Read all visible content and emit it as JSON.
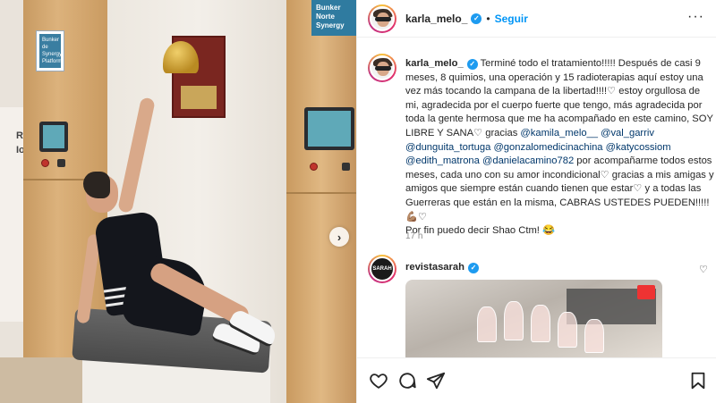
{
  "photo": {
    "sign_left_text": "Bunker de Synergy Platform",
    "sign_right_text": "Bunker Norte Synergy",
    "wall_text_line1": "Rad",
    "wall_text_line2": "Ion",
    "next_button": "›"
  },
  "header": {
    "username": "karla_melo_",
    "verified": "✓",
    "separator": "•",
    "follow_label": "Seguir",
    "more_label": "···"
  },
  "caption": {
    "username": "karla_melo_",
    "text_1": " Terminé todo el tratamiento!!!!! Después de casi 9 meses, 8 quimios, una operación y 15 radioterapias aquí estoy una vez más tocando la campana de la libertad!!!!",
    "heart_1": "♡",
    "text_2": " estoy orgullosa de mi, agradecida por el cuerpo fuerte que tengo, más agradecida por toda la gente hermosa que me ha acompañado en este camino, SOY LIBRE Y SANA",
    "heart_2": "♡",
    "text_3": " gracias ",
    "mention_1": "@kamila_melo__",
    "mention_2": "@val_garriv",
    "mention_3": "@dunguita_tortuga",
    "mention_4": "@gonzalomedicinachina",
    "mention_5": "@katycossiom",
    "mention_6": "@edith_matrona",
    "mention_7": "@danielacamino782",
    "text_4": " por acompañarme todos estos meses, cada uno con su amor incondicional",
    "heart_3": "♡",
    "text_5": " gracias a mis amigas y amigos que siempre están cuando tienen que estar",
    "heart_4": "♡",
    "text_6": " y a todas las Guerreras que están en la misma, CABRAS USTEDES PUEDEN!!!!!",
    "emoji_1": "💪🏽",
    "heart_5": "♡",
    "text_7": "Por fin puedo decir Shao Ctm! ",
    "emoji_2": "😂",
    "time": "17 h"
  },
  "comment": {
    "avatar_text": "SARAH",
    "username": "revistasarah",
    "verified": "✓",
    "like": "♡"
  },
  "colors": {
    "accent": "#0095f6",
    "mention": "#00376b",
    "verified": "#1d9bf0"
  },
  "icons": [
    "heart-icon",
    "comment-icon",
    "share-icon",
    "bookmark-icon"
  ]
}
